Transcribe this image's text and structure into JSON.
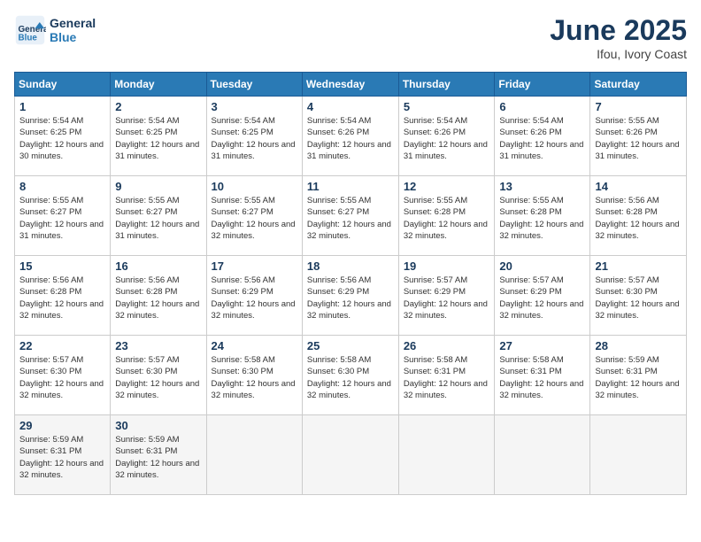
{
  "header": {
    "logo_line1": "General",
    "logo_line2": "Blue",
    "month": "June 2025",
    "location": "Ifou, Ivory Coast"
  },
  "weekdays": [
    "Sunday",
    "Monday",
    "Tuesday",
    "Wednesday",
    "Thursday",
    "Friday",
    "Saturday"
  ],
  "weeks": [
    [
      {
        "day": "1",
        "sunrise": "5:54 AM",
        "sunset": "6:25 PM",
        "daylight": "12 hours and 30 minutes."
      },
      {
        "day": "2",
        "sunrise": "5:54 AM",
        "sunset": "6:25 PM",
        "daylight": "12 hours and 31 minutes."
      },
      {
        "day": "3",
        "sunrise": "5:54 AM",
        "sunset": "6:25 PM",
        "daylight": "12 hours and 31 minutes."
      },
      {
        "day": "4",
        "sunrise": "5:54 AM",
        "sunset": "6:26 PM",
        "daylight": "12 hours and 31 minutes."
      },
      {
        "day": "5",
        "sunrise": "5:54 AM",
        "sunset": "6:26 PM",
        "daylight": "12 hours and 31 minutes."
      },
      {
        "day": "6",
        "sunrise": "5:54 AM",
        "sunset": "6:26 PM",
        "daylight": "12 hours and 31 minutes."
      },
      {
        "day": "7",
        "sunrise": "5:55 AM",
        "sunset": "6:26 PM",
        "daylight": "12 hours and 31 minutes."
      }
    ],
    [
      {
        "day": "8",
        "sunrise": "5:55 AM",
        "sunset": "6:27 PM",
        "daylight": "12 hours and 31 minutes."
      },
      {
        "day": "9",
        "sunrise": "5:55 AM",
        "sunset": "6:27 PM",
        "daylight": "12 hours and 31 minutes."
      },
      {
        "day": "10",
        "sunrise": "5:55 AM",
        "sunset": "6:27 PM",
        "daylight": "12 hours and 32 minutes."
      },
      {
        "day": "11",
        "sunrise": "5:55 AM",
        "sunset": "6:27 PM",
        "daylight": "12 hours and 32 minutes."
      },
      {
        "day": "12",
        "sunrise": "5:55 AM",
        "sunset": "6:28 PM",
        "daylight": "12 hours and 32 minutes."
      },
      {
        "day": "13",
        "sunrise": "5:55 AM",
        "sunset": "6:28 PM",
        "daylight": "12 hours and 32 minutes."
      },
      {
        "day": "14",
        "sunrise": "5:56 AM",
        "sunset": "6:28 PM",
        "daylight": "12 hours and 32 minutes."
      }
    ],
    [
      {
        "day": "15",
        "sunrise": "5:56 AM",
        "sunset": "6:28 PM",
        "daylight": "12 hours and 32 minutes."
      },
      {
        "day": "16",
        "sunrise": "5:56 AM",
        "sunset": "6:28 PM",
        "daylight": "12 hours and 32 minutes."
      },
      {
        "day": "17",
        "sunrise": "5:56 AM",
        "sunset": "6:29 PM",
        "daylight": "12 hours and 32 minutes."
      },
      {
        "day": "18",
        "sunrise": "5:56 AM",
        "sunset": "6:29 PM",
        "daylight": "12 hours and 32 minutes."
      },
      {
        "day": "19",
        "sunrise": "5:57 AM",
        "sunset": "6:29 PM",
        "daylight": "12 hours and 32 minutes."
      },
      {
        "day": "20",
        "sunrise": "5:57 AM",
        "sunset": "6:29 PM",
        "daylight": "12 hours and 32 minutes."
      },
      {
        "day": "21",
        "sunrise": "5:57 AM",
        "sunset": "6:30 PM",
        "daylight": "12 hours and 32 minutes."
      }
    ],
    [
      {
        "day": "22",
        "sunrise": "5:57 AM",
        "sunset": "6:30 PM",
        "daylight": "12 hours and 32 minutes."
      },
      {
        "day": "23",
        "sunrise": "5:57 AM",
        "sunset": "6:30 PM",
        "daylight": "12 hours and 32 minutes."
      },
      {
        "day": "24",
        "sunrise": "5:58 AM",
        "sunset": "6:30 PM",
        "daylight": "12 hours and 32 minutes."
      },
      {
        "day": "25",
        "sunrise": "5:58 AM",
        "sunset": "6:30 PM",
        "daylight": "12 hours and 32 minutes."
      },
      {
        "day": "26",
        "sunrise": "5:58 AM",
        "sunset": "6:31 PM",
        "daylight": "12 hours and 32 minutes."
      },
      {
        "day": "27",
        "sunrise": "5:58 AM",
        "sunset": "6:31 PM",
        "daylight": "12 hours and 32 minutes."
      },
      {
        "day": "28",
        "sunrise": "5:59 AM",
        "sunset": "6:31 PM",
        "daylight": "12 hours and 32 minutes."
      }
    ],
    [
      {
        "day": "29",
        "sunrise": "5:59 AM",
        "sunset": "6:31 PM",
        "daylight": "12 hours and 32 minutes."
      },
      {
        "day": "30",
        "sunrise": "5:59 AM",
        "sunset": "6:31 PM",
        "daylight": "12 hours and 32 minutes."
      },
      null,
      null,
      null,
      null,
      null
    ]
  ]
}
